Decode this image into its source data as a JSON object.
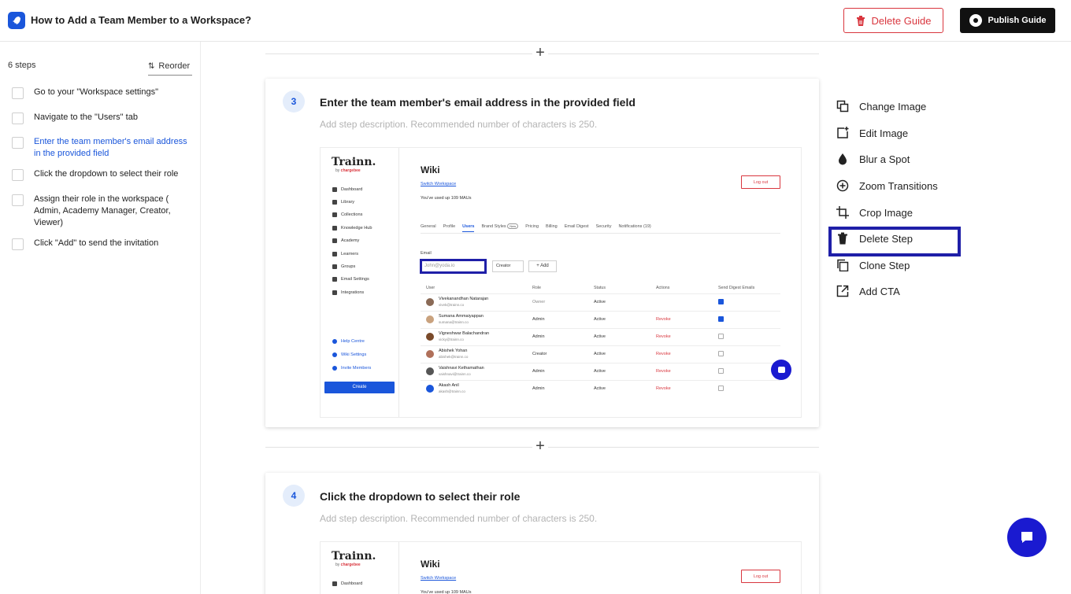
{
  "header": {
    "title": "How to Add a Team Member to a Workspace?",
    "delete_guide": "Delete Guide",
    "publish_guide": "Publish Guide"
  },
  "sidebar": {
    "steps_count": "6 steps",
    "reorder": "Reorder",
    "steps": [
      "Go to your \"Workspace settings\"",
      "Navigate to the \"Users\" tab",
      "Enter the team member's email address in the provided field",
      "Click the dropdown to select their role",
      "Assign their role in the workspace ( Admin, Academy Manager, Creator, Viewer)",
      "Click \"Add\" to send the invitation"
    ],
    "active_index": 2
  },
  "cards": [
    {
      "number": "3",
      "title": "Enter the team member's email address in the provided field",
      "description": "Add step description. Recommended number of characters is 250."
    },
    {
      "number": "4",
      "title": "Click the dropdown to select their role",
      "description": "Add step description. Recommended number of characters is 250."
    }
  ],
  "screenshot": {
    "brand": "Trainn.",
    "brand_by": "by",
    "brand_sub": "chargebee",
    "nav": [
      "Dashboard",
      "Library",
      "Collections",
      "Knowledge Hub",
      "Academy",
      "Learners",
      "Groups",
      "Email Settings",
      "Integrations"
    ],
    "bottom_links": [
      "Help Centre",
      "Wiki Settings",
      "Invite Members"
    ],
    "create": "Create",
    "heading": "Wiki",
    "switch": "Switch Workspace",
    "mau": "You've used up 109 MAUs",
    "logout": "Log out",
    "tabs": [
      "General",
      "Profile",
      "Users",
      "Brand Styles",
      "Pricing",
      "Billing",
      "Email Digest",
      "Security",
      "Notifications (19)"
    ],
    "new_badge": "New",
    "email_label": "Email",
    "email_placeholder": "John@yoda.io",
    "role_select": "Creator",
    "add_button": "+ Add",
    "table_headers": [
      "User",
      "Role",
      "Status",
      "Actions",
      "Send Digest Emails"
    ],
    "rows": [
      {
        "name": "Vivekanandhan Natarajan",
        "email": "vivek@trainn.co",
        "role": "Owner",
        "status": "Active",
        "action": "",
        "digest": true
      },
      {
        "name": "Sumana Ammaiyappan",
        "email": "sumana@trainn.co",
        "role": "Admin",
        "status": "Active",
        "action": "Revoke",
        "digest": true
      },
      {
        "name": "Vigneshwar Balachandran",
        "email": "vicky@trainn.co",
        "role": "Admin",
        "status": "Active",
        "action": "Revoke",
        "digest": false
      },
      {
        "name": "Abishek Yohan",
        "email": "abishek@trainn.co",
        "role": "Creator",
        "status": "Active",
        "action": "Revoke",
        "digest": false
      },
      {
        "name": "Vaishnavi Kethamathan",
        "email": "vaishnavi@trainn.co",
        "role": "Admin",
        "status": "Active",
        "action": "Revoke",
        "digest": false
      },
      {
        "name": "Akash Anil",
        "email": "akash@trainn.co",
        "role": "Admin",
        "status": "Active",
        "action": "Revoke",
        "digest": false
      }
    ]
  },
  "actions": [
    {
      "label": "Change Image",
      "icon": "change-image-icon"
    },
    {
      "label": "Edit Image",
      "icon": "edit-image-icon"
    },
    {
      "label": "Blur a Spot",
      "icon": "blur-icon"
    },
    {
      "label": "Zoom Transitions",
      "icon": "zoom-icon"
    },
    {
      "label": "Crop Image",
      "icon": "crop-icon"
    },
    {
      "label": "Delete Step",
      "icon": "trash-icon"
    },
    {
      "label": "Clone Step",
      "icon": "clone-icon"
    },
    {
      "label": "Add CTA",
      "icon": "external-link-icon"
    }
  ],
  "colors": {
    "accent": "#1a56db",
    "danger": "#d9363e",
    "highlight": "#1f1fa8",
    "chat": "#1a1ad0"
  }
}
